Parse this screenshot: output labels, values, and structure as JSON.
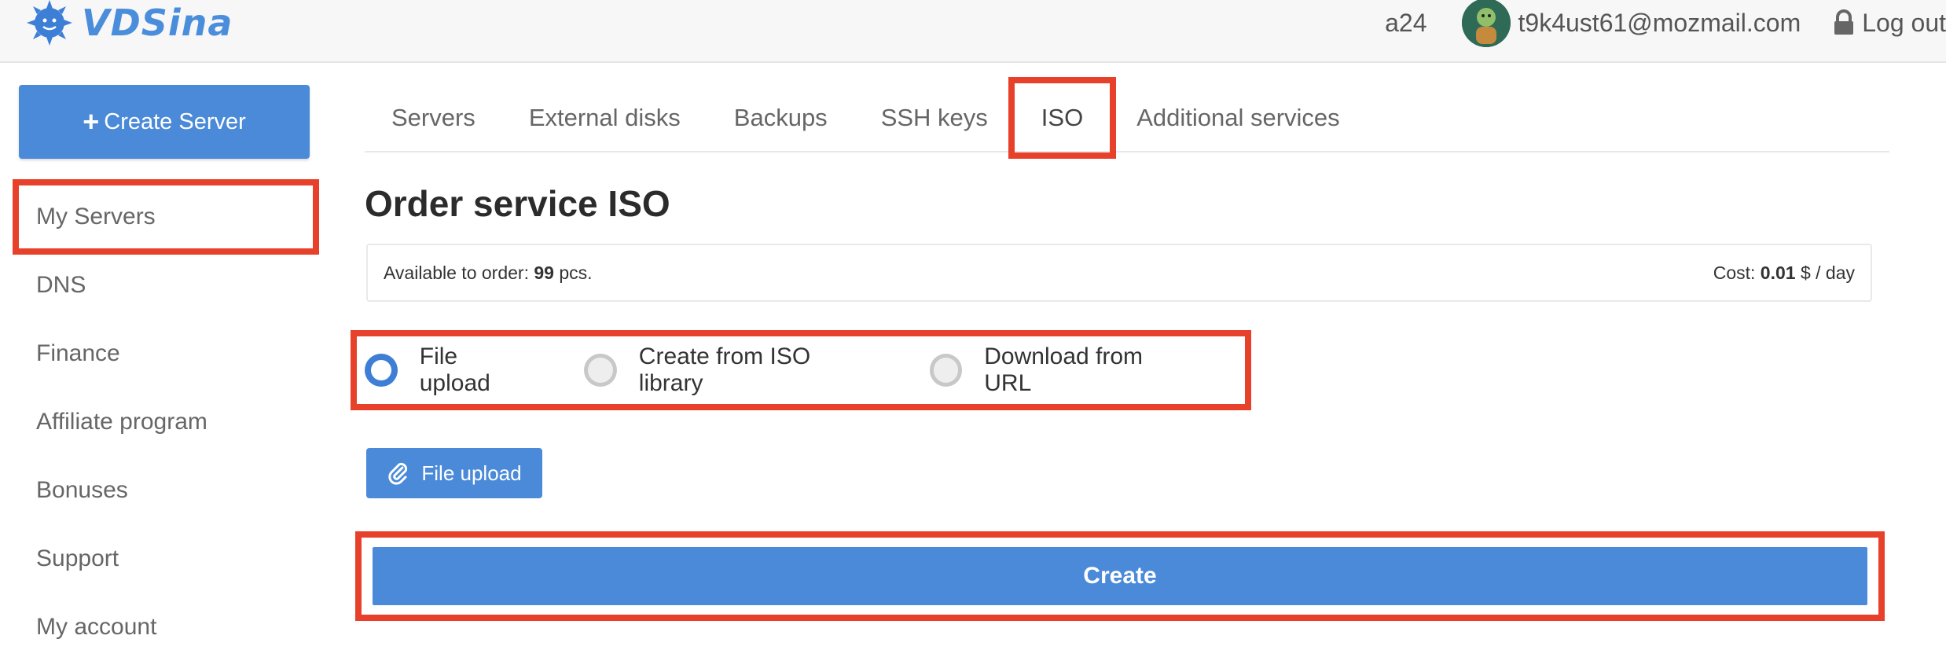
{
  "header": {
    "logo_text": "VDSina",
    "account": "a24",
    "email": "t9k4ust61@mozmail.com",
    "logout_label": "Log out"
  },
  "sidebar": {
    "create_label": "Create Server",
    "items": [
      {
        "label": "My Servers"
      },
      {
        "label": "DNS"
      },
      {
        "label": "Finance"
      },
      {
        "label": "Affiliate program"
      },
      {
        "label": "Bonuses"
      },
      {
        "label": "Support"
      },
      {
        "label": "My account"
      }
    ]
  },
  "tabs": [
    {
      "label": "Servers"
    },
    {
      "label": "External disks"
    },
    {
      "label": "Backups"
    },
    {
      "label": "SSH keys"
    },
    {
      "label": "ISO"
    },
    {
      "label": "Additional services"
    }
  ],
  "main": {
    "title": "Order service ISO",
    "available_prefix": "Available to order: ",
    "available_value": "99",
    "available_suffix": " pcs.",
    "cost_prefix": "Cost: ",
    "cost_value": "0.01",
    "cost_suffix": " $ / day",
    "radio_options": [
      {
        "label": "File upload",
        "selected": true
      },
      {
        "label": "Create from ISO library",
        "selected": false
      },
      {
        "label": "Download from URL",
        "selected": false
      }
    ],
    "upload_label": "File upload",
    "submit_label": "Create"
  },
  "colors": {
    "accent": "#4a8ad8",
    "highlight": "#e8412b"
  },
  "icons": [
    "logo-icon",
    "lock-icon",
    "plus-icon",
    "paperclip-icon"
  ]
}
